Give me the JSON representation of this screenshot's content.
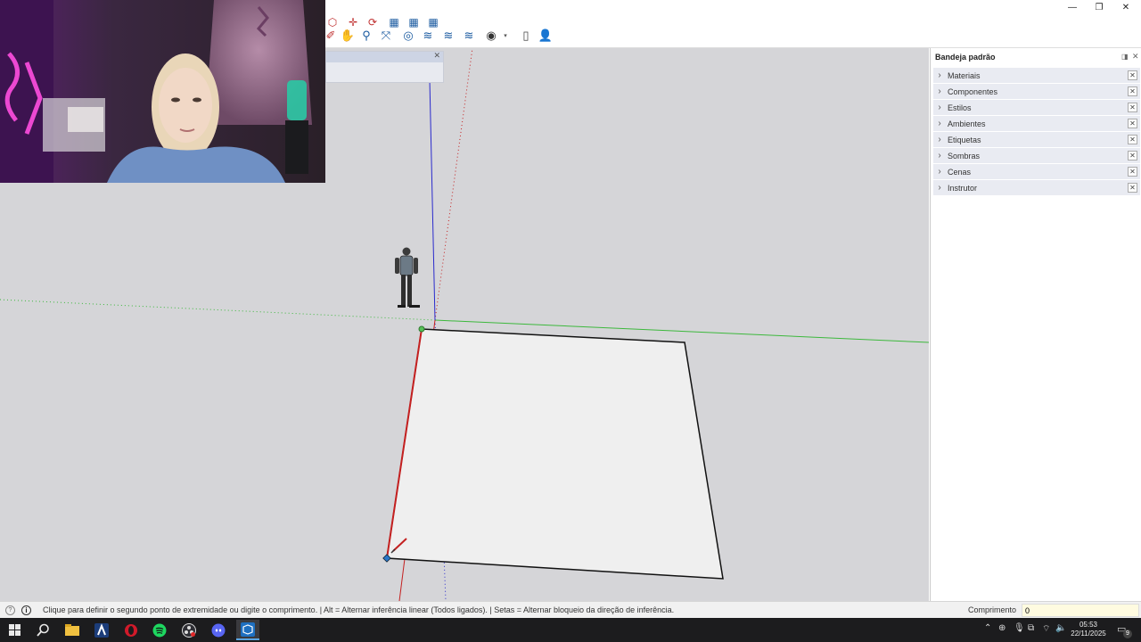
{
  "window": {
    "minimize_glyph": "—",
    "restore_glyph": "❐",
    "close_glyph": "✕"
  },
  "toolbar": {
    "icons": [
      "eraser-icon",
      "pan-hand-icon",
      "zoom-icon",
      "zoom-extents-icon",
      "section-plane-icon",
      "display-section-icon",
      "section-fill-icon",
      "section-cuts-icon",
      "account-icon",
      "dropdown-icon",
      "new-file-icon",
      "user-profile-icon"
    ]
  },
  "floating_toolbar": {
    "close_glyph": "✕",
    "icons": [
      "component-icon",
      "move-icon",
      "rotate-icon",
      "surface-mesh-icon",
      "surface-mesh-2-icon",
      "surface-mesh-3-icon"
    ]
  },
  "tray": {
    "title": "Bandeja padrão",
    "items": [
      {
        "label": "Materiais"
      },
      {
        "label": "Componentes"
      },
      {
        "label": "Estilos"
      },
      {
        "label": "Ambientes"
      },
      {
        "label": "Etiquetas"
      },
      {
        "label": "Sombras"
      },
      {
        "label": "Cenas"
      },
      {
        "label": "Instrutor"
      }
    ]
  },
  "status": {
    "message": "Clique para definir o segundo ponto de extremidade ou digite o comprimento. | Alt = Alternar inferência linear (Todos ligados). | Setas = Alternar bloqueio da direção de inferência.",
    "measure_label": "Comprimento",
    "measure_value": "0"
  },
  "taskbar": {
    "apps": [
      "windows-start",
      "search",
      "file-explorer",
      "app-a",
      "opera",
      "spotify",
      "obs-studio",
      "discord",
      "sketchup"
    ],
    "time": "05:53",
    "date": "22/11/2025",
    "notification_count": "9"
  },
  "colors": {
    "viewport_bg": "#d5d5d8",
    "axis_red": "#c42020",
    "axis_green": "#3cb83c",
    "axis_blue": "#2a2acc",
    "tray_item_bg": "#e9ebf2",
    "accent": "#1a5aa0"
  }
}
